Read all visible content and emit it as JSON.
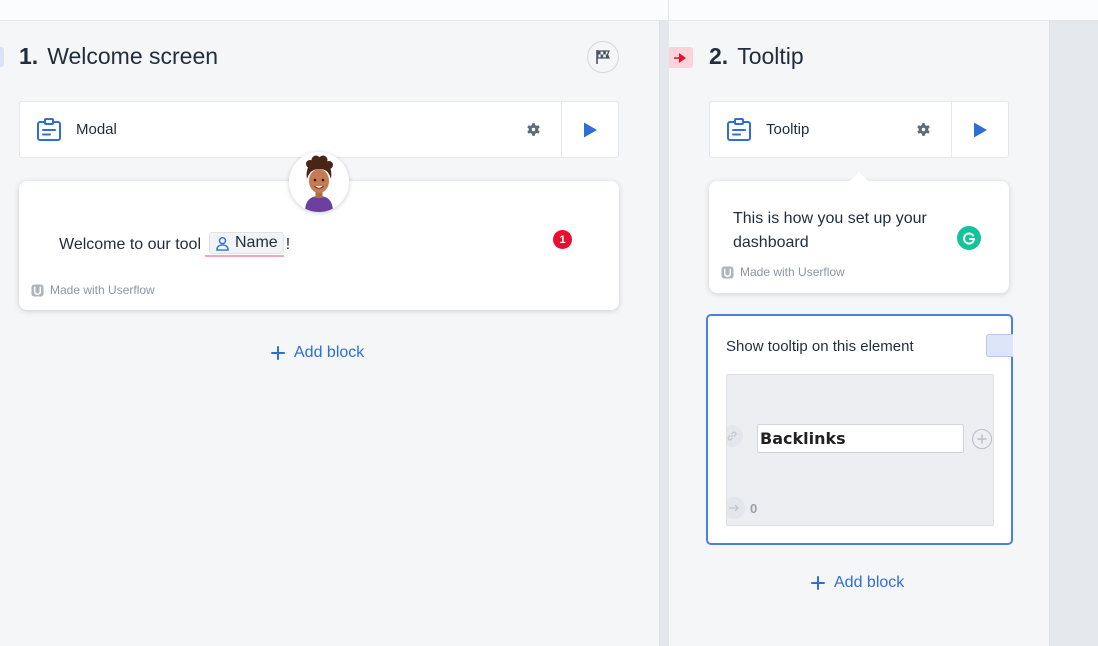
{
  "steps": [
    {
      "number": "1.",
      "title": "Welcome screen",
      "type_label": "Modal",
      "content": {
        "text_before": "Welcome to our tool",
        "attribute_chip": "Name",
        "text_after": "!",
        "issue_count": "1",
        "branding": "Made with Userflow"
      },
      "add_block_label": "Add block"
    },
    {
      "number": "2.",
      "title": "Tooltip",
      "type_label": "Tooltip",
      "content": {
        "text": "This is how you set up your dashboard",
        "branding": "Made with Userflow"
      },
      "element_selector": {
        "label": "Show tooltip on this element",
        "preview_input_value": "Backlinks",
        "preview_count": "0"
      },
      "add_block_label": "Add block"
    }
  ],
  "colors": {
    "accent": "#2e6fd6",
    "badge": "#e8102f",
    "selection_border": "#4f7fdc",
    "grammarly": "#15c39a",
    "trigger_marker": "#fbd3d9"
  },
  "icons": {
    "step_type": "modal-card-icon",
    "settings": "gear-icon",
    "preview": "play-icon",
    "goal": "checkered-flag-icon",
    "trigger": "trigger-arrow-icon",
    "add": "plus-icon",
    "user": "user-icon",
    "branding": "userflow-logo-icon"
  }
}
